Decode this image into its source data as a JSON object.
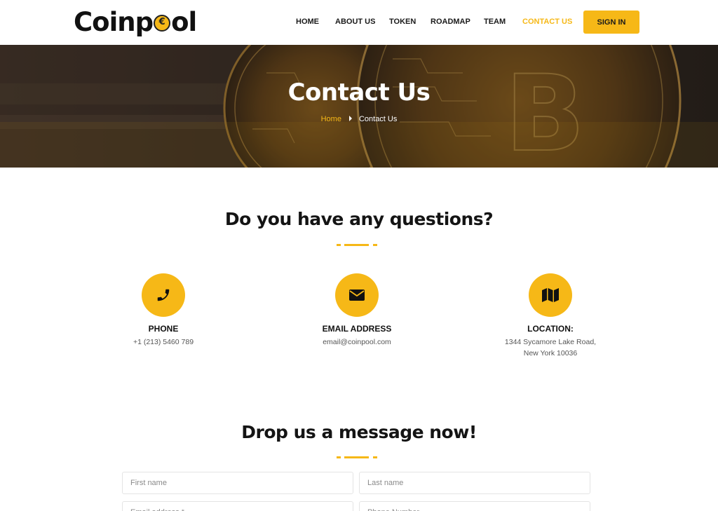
{
  "header": {
    "logo_text_start": "Coinp",
    "logo_text_end": "ol",
    "nav": [
      {
        "label": "HOME",
        "active": false
      },
      {
        "label": "ABOUT US",
        "active": false
      },
      {
        "label": "TOKEN",
        "active": false
      },
      {
        "label": "ROADMAP",
        "active": false
      },
      {
        "label": "TEAM",
        "active": false
      },
      {
        "label": "CONTACT US",
        "active": true
      }
    ],
    "signin_label": "SIGN IN"
  },
  "hero": {
    "title": "Contact Us",
    "breadcrumb_home": "Home",
    "breadcrumb_current": "Contact Us"
  },
  "questions": {
    "title": "Do you have any questions?",
    "items": [
      {
        "icon": "phone-icon",
        "heading": "PHONE",
        "lines": [
          "+1 (213) 5460 789"
        ]
      },
      {
        "icon": "envelope-icon",
        "heading": "EMAIL ADDRESS",
        "lines": [
          "email@coinpool.com"
        ]
      },
      {
        "icon": "map-icon",
        "heading": "LOCATION:",
        "lines": [
          "1344 Sycamore Lake Road,",
          "New York 10036"
        ]
      }
    ]
  },
  "message": {
    "title": "Drop us a message now!",
    "first_name_placeholder": "First name",
    "last_name_placeholder": "Last name",
    "email_placeholder": "Email address *",
    "phone_placeholder": "Phone Number"
  },
  "colors": {
    "accent": "#f6b817",
    "text": "#141414"
  }
}
